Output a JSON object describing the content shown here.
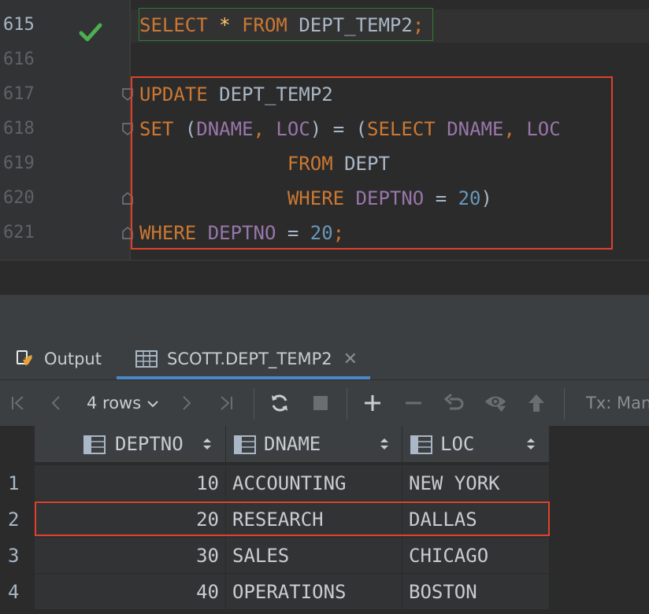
{
  "editor": {
    "lines": [
      {
        "num": "615"
      },
      {
        "num": "616"
      },
      {
        "num": "617"
      },
      {
        "num": "618"
      },
      {
        "num": "619"
      },
      {
        "num": "620"
      },
      {
        "num": "621"
      }
    ],
    "tokens": {
      "l615": [
        "SELECT",
        "*",
        "FROM",
        "DEPT_TEMP2",
        ";"
      ],
      "l617": [
        "UPDATE",
        "DEPT_TEMP2"
      ],
      "l618": [
        "SET",
        "(",
        "DNAME",
        ",",
        "LOC",
        ")",
        "=",
        "(",
        "SELECT",
        "DNAME",
        ",",
        "LOC"
      ],
      "l619": [
        "FROM",
        "DEPT"
      ],
      "l620": [
        "WHERE",
        "DEPTNO",
        "=",
        "20",
        ")"
      ],
      "l621": [
        "WHERE",
        "DEPTNO",
        "=",
        "20",
        ";"
      ]
    },
    "status_icon": "checkmark-icon",
    "colors": {
      "keyword": "#cc7832",
      "column": "#9876aa",
      "number": "#6897bb",
      "highlight_box": "#e0412b",
      "success": "#4caf50"
    }
  },
  "tabs": [
    {
      "label": "Output",
      "icon": "output-icon"
    },
    {
      "label": "SCOTT.DEPT_TEMP2",
      "icon": "table-icon",
      "active": true
    }
  ],
  "toolbar": {
    "rows_label": "4 rows",
    "tx_label": "Tx: Manu"
  },
  "grid": {
    "columns": [
      "DEPTNO",
      "DNAME",
      "LOC"
    ],
    "rows": [
      {
        "index": "1",
        "deptno": "10",
        "dname": "ACCOUNTING",
        "loc": "NEW YORK"
      },
      {
        "index": "2",
        "deptno": "20",
        "dname": "RESEARCH",
        "loc": "DALLAS"
      },
      {
        "index": "3",
        "deptno": "30",
        "dname": "SALES",
        "loc": "CHICAGO"
      },
      {
        "index": "4",
        "deptno": "40",
        "dname": "OPERATIONS",
        "loc": "BOSTON"
      }
    ]
  }
}
